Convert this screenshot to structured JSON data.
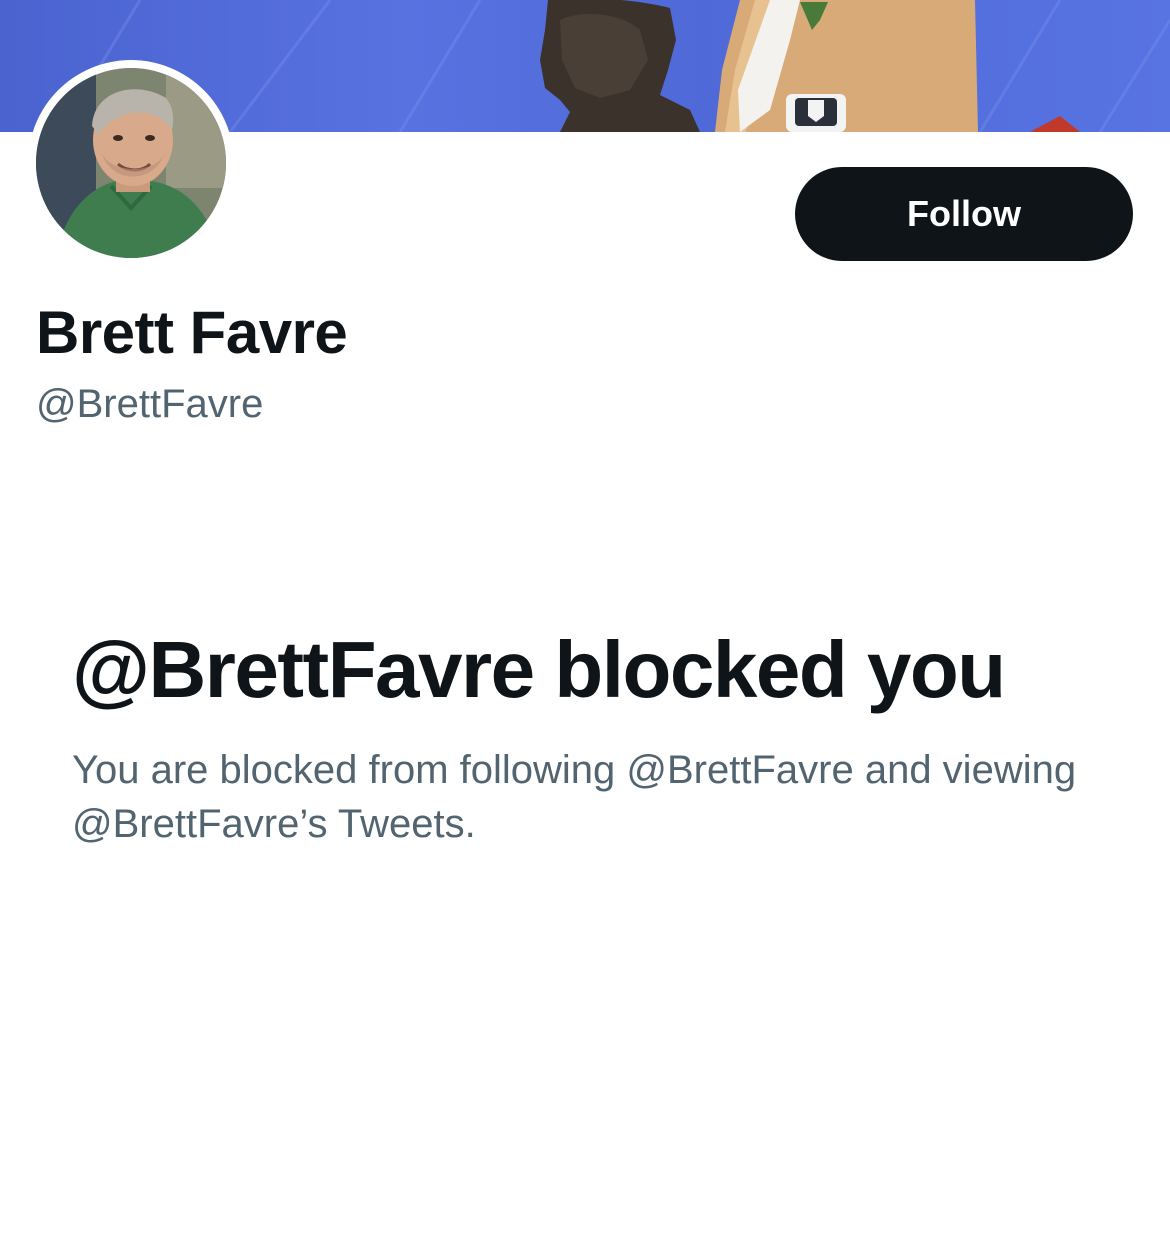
{
  "profile": {
    "display_name": "Brett Favre",
    "handle": "@BrettFavre"
  },
  "actions": {
    "follow_label": "Follow"
  },
  "blocked_notice": {
    "title": "@BrettFavre blocked you",
    "description": "You are blocked from following @BrettFavre and viewing @BrettFavre’s Tweets."
  },
  "colors": {
    "primary_text": "#0f1419",
    "secondary_text": "#536471",
    "button_bg": "#0f1419",
    "button_text": "#ffffff",
    "banner_blue": "#5268d8"
  }
}
